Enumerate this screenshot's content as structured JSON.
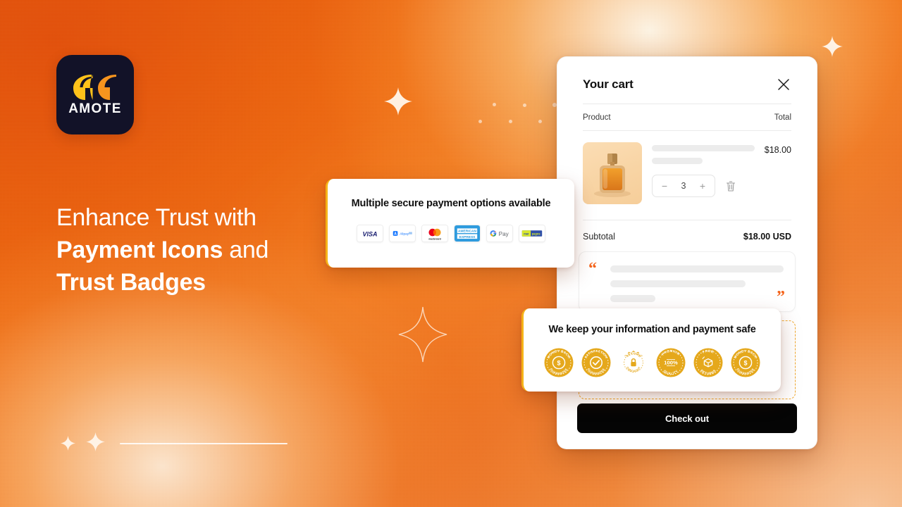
{
  "brand": {
    "name": "AMOTE",
    "logo_icon": "double-quote-icon",
    "logo_bg": "#121228",
    "quote_color_left": "#FFC21A",
    "quote_color_right": "#F7941E"
  },
  "headline": {
    "line1_regular": "Enhance Trust with",
    "line2_bold": "Payment Icons",
    "line2_regular": " and",
    "line3_bold": "Trust Badges"
  },
  "payment_card": {
    "title": "Multiple secure payment options available",
    "accent_color": "#F5B318",
    "icons": [
      {
        "name": "visa-icon",
        "label": "VISA"
      },
      {
        "name": "alipay-icon",
        "label": "Alipay"
      },
      {
        "name": "mastercard-icon",
        "label": "mastercard"
      },
      {
        "name": "amex-icon",
        "label": "AMERICAN EXPRESS"
      },
      {
        "name": "google-pay-icon",
        "label": "G Pay"
      },
      {
        "name": "mercado-pago-icon",
        "label": "mercado pago"
      }
    ]
  },
  "trust_card": {
    "title": "We keep your information and payment safe",
    "accent_color": "#F5B318",
    "badge_color": "#E5A81C",
    "badges": [
      {
        "name": "money-back-guarantee-badge",
        "top": "MONEY BACK",
        "bottom": "GUARANTEE",
        "glyph": "$"
      },
      {
        "name": "satisfaction-guarantee-badge",
        "top": "SATISFACTION",
        "bottom": "GUARANTEE",
        "glyph": "check"
      },
      {
        "name": "secure-checkout-badge",
        "top": "SECURE",
        "bottom": "CHECKOUT",
        "glyph": "lock"
      },
      {
        "name": "premium-quality-badge",
        "top": "PREMIUM",
        "bottom": "QUALITY",
        "glyph": "100%"
      },
      {
        "name": "free-returns-badge",
        "top": "FREE",
        "bottom": "RETURNS",
        "glyph": "box"
      },
      {
        "name": "money-back-guarantee-badge",
        "top": "MONEY BACK",
        "bottom": "GUARANTEE",
        "glyph": "$"
      }
    ]
  },
  "cart": {
    "title": "Your cart",
    "close_icon": "close-icon",
    "columns": {
      "product": "Product",
      "total": "Total"
    },
    "item": {
      "thumbnail_icon": "perfume-bottle-image",
      "line_total": "$18.00",
      "quantity": "3",
      "decrease_label": "−",
      "increase_label": "+",
      "remove_icon": "trash-icon"
    },
    "subtotal_label": "Subtotal",
    "subtotal_value": "$18.00 USD",
    "quote_open": "“",
    "quote_close": "”",
    "quote_accent": "#F4641B",
    "checkout_label": "Check out",
    "checkout_bg": "#050505"
  },
  "decor": {
    "sparkle_filled_icon": "sparkle-icon",
    "sparkle_outline_icon": "sparkle-outline-icon",
    "divider_icon": "horizontal-rule"
  },
  "theme": {
    "background_orange": "#F0700F",
    "background_highlight": "#FFF6E6",
    "card_white": "#FFFFFF"
  }
}
